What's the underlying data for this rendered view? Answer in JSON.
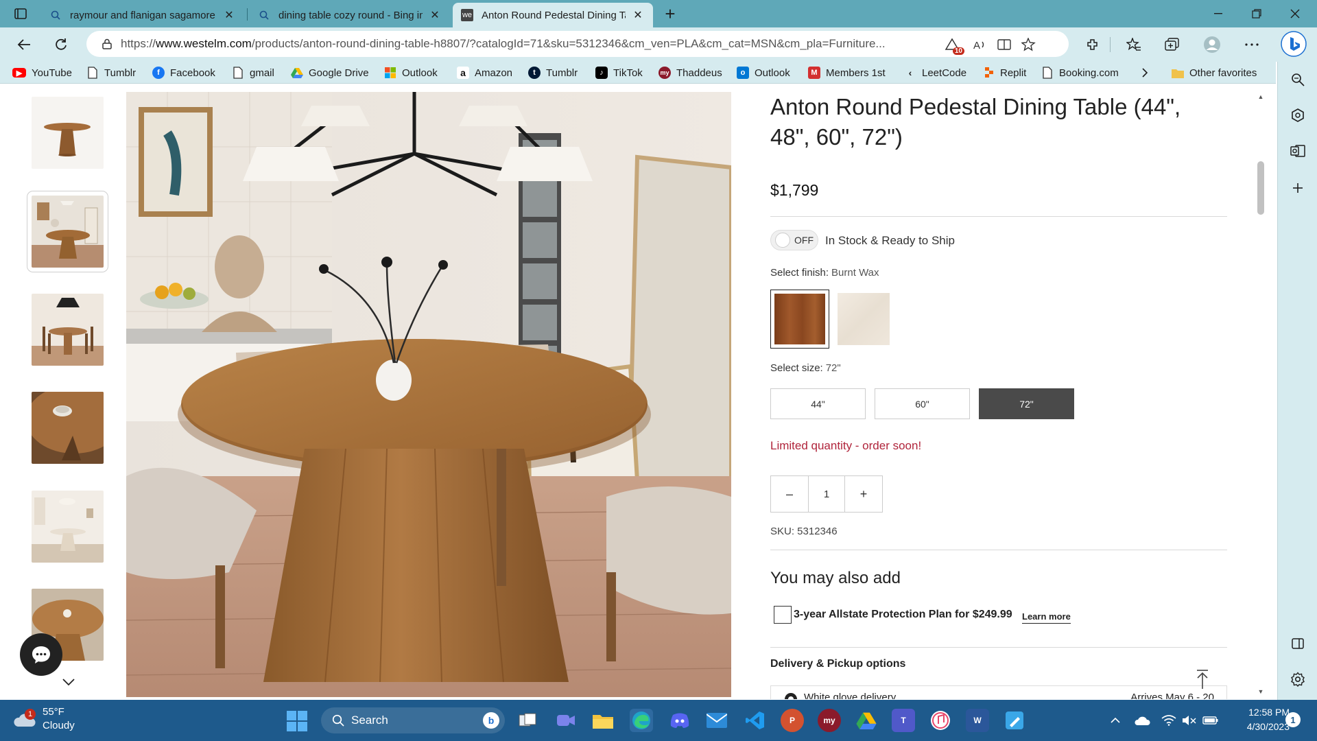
{
  "browser": {
    "tabs": [
      {
        "label": "raymour and flanigan sagamore",
        "icon": "search-icon"
      },
      {
        "label": "dining table cozy round - Bing im",
        "icon": "search-icon"
      },
      {
        "label": "Anton Round Pedestal Dining Tal",
        "icon": "we-favicon",
        "active": true
      }
    ],
    "url_prefix": "https://",
    "url_host": "www.westelm.com",
    "url_rest": "/products/anton-round-dining-table-h8807/?catalogId=71&sku=5312346&cm_ven=PLA&cm_cat=MSN&cm_pla=Furniture...",
    "tracking_badge": "10",
    "favicon_text": "we"
  },
  "favorites": [
    {
      "label": "YouTube",
      "icon": "youtube-icon",
      "color": "#ff0000"
    },
    {
      "label": "Tumblr",
      "icon": "page-icon",
      "color": ""
    },
    {
      "label": "Facebook",
      "icon": "facebook-icon",
      "color": "#1877f2"
    },
    {
      "label": "gmail",
      "icon": "page-icon",
      "color": ""
    },
    {
      "label": "Google Drive",
      "icon": "google-drive-icon",
      "color": "#34a853"
    },
    {
      "label": "Outlook",
      "icon": "microsoft-icon",
      "color": "#f25022"
    },
    {
      "label": "Amazon",
      "icon": "amazon-icon",
      "color": "#ffffff"
    },
    {
      "label": "Tumblr",
      "icon": "tumblr-icon",
      "color": "#001935"
    },
    {
      "label": "TikTok",
      "icon": "tiktok-icon",
      "color": "#000000"
    },
    {
      "label": "Thaddeus",
      "icon": "my-icon",
      "color": "#8b1a2b"
    },
    {
      "label": "Outlook",
      "icon": "outlook-icon",
      "color": "#0078d4"
    },
    {
      "label": "Members 1st",
      "icon": "m-icon",
      "color": "#d32f2f"
    },
    {
      "label": "LeetCode",
      "icon": "leetcode-icon",
      "color": "#222"
    },
    {
      "label": "Replit",
      "icon": "replit-icon",
      "color": "#f26207"
    },
    {
      "label": "Booking.com",
      "icon": "page-icon",
      "color": ""
    }
  ],
  "other_favorites": "Other favorites",
  "product": {
    "title": "Anton Round Pedestal Dining Table (44\", 48\", 60\", 72\")",
    "price": "$1,799",
    "toggle_label": "OFF",
    "in_stock_label": "In Stock & Ready to Ship",
    "finish_label": "Select finish:",
    "finish_value": "Burnt Wax",
    "finishes": [
      {
        "name": "Burnt Wax",
        "color": "#8b4a22",
        "selected": true
      },
      {
        "name": "",
        "color": "#ece3d6",
        "selected": false
      }
    ],
    "size_label": "Select size:",
    "size_value": "72\"",
    "sizes": [
      {
        "label": "44\"",
        "selected": false
      },
      {
        "label": "60\"",
        "selected": false
      },
      {
        "label": "72\"",
        "selected": true
      }
    ],
    "limited": "Limited quantity - order soon!",
    "qty_minus": "–",
    "qty_value": "1",
    "qty_plus": "+",
    "sku": "SKU: 5312346",
    "also_title": "You may also add",
    "protection": "3-year Allstate Protection Plan for $249.99",
    "learn_more": "Learn more",
    "delivery_title": "Delivery & Pickup options",
    "delivery_option": "White glove delivery",
    "delivery_arrives": "Arrives May 6 - 20"
  },
  "taskbar": {
    "weather_temp": "55°F",
    "weather_cond": "Cloudy",
    "weather_badge": "1",
    "search_label": "Search",
    "time": "12:58 PM",
    "date": "4/30/2023",
    "notif_count": "1",
    "apps": [
      "task-view",
      "teams-chat",
      "file-explorer",
      "edge",
      "discord",
      "mail",
      "vscode",
      "powerpoint",
      "my-app",
      "google-drive",
      "teams",
      "itunes",
      "word",
      "paint"
    ]
  }
}
